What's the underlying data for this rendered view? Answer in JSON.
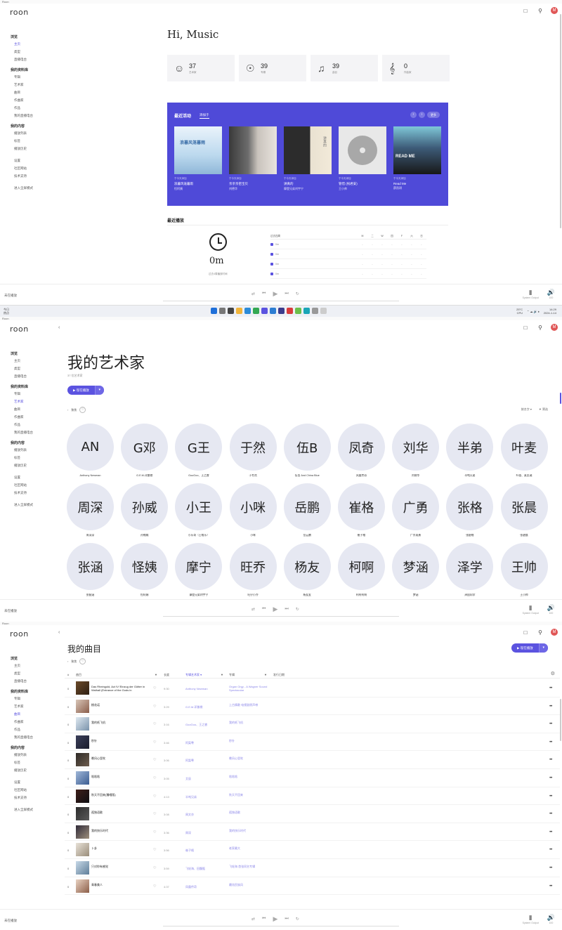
{
  "logo": "roon",
  "sidebar": {
    "sections": [
      {
        "header": "浏览",
        "items": [
          "主页",
          "类型",
          "直播电台"
        ]
      },
      {
        "header": "我的资料库",
        "items": [
          "专辑",
          "艺术家",
          "曲目",
          "作曲家",
          "作品",
          "我的直播电台"
        ]
      },
      {
        "header": "我的内容",
        "items": [
          "播放列表",
          "标签",
          "播放历史"
        ]
      },
      {
        "header": "",
        "items": [
          "设置",
          "社区网站",
          "技术支持"
        ]
      },
      {
        "header": "",
        "items": [
          "进入全屏模式"
        ]
      }
    ]
  },
  "top_icons": {
    "bookmark": "bookmark-icon",
    "search": "search-icon",
    "avatar": "M"
  },
  "playbar": {
    "status": "未在播放",
    "output_label": "System Output",
    "volume_label": "100"
  },
  "home": {
    "titlebar": "Roon",
    "greeting": "Hi, Music",
    "stats": [
      {
        "icon": "artist-icon",
        "value": "37",
        "label": "艺术家"
      },
      {
        "icon": "album-icon",
        "value": "39",
        "label": "专辑"
      },
      {
        "icon": "track-icon",
        "value": "39",
        "label": "曲目"
      },
      {
        "icon": "composer-icon",
        "value": "0",
        "label": "作曲家"
      }
    ],
    "activity": {
      "title": "最近活动",
      "tab": "添加于",
      "more": "更多",
      "cards": [
        {
          "meta": "于今天添加",
          "name": "浪暮风笼暮雨",
          "artist": "恒阿姨",
          "cover_text": "浪暮风笼暮雨"
        },
        {
          "meta": "于今天添加",
          "name": "亲亲亲密宝贝",
          "artist": "刘德华",
          "cover_text": ""
        },
        {
          "meta": "于今天添加",
          "name": "讲真的",
          "artist": "摩登兄弟刘宇宁",
          "cover_text": "讲真的"
        },
        {
          "meta": "于今天添加",
          "name": "管惜 (祝君安)",
          "artist": "王小帅",
          "cover_text": ""
        },
        {
          "meta": "于今天添加",
          "name": "Read Me",
          "artist": "薛凯琪",
          "cover_text": "READ ME"
        }
      ]
    },
    "recent": {
      "title": "最近播放",
      "value": "0m",
      "caption": "过去4周播放时间",
      "table_header": "过去四周",
      "days": [
        "M",
        "二",
        "W",
        "四",
        "F",
        "六",
        "日"
      ],
      "rows": [
        {
          "label": "0m",
          "cells": [
            "-",
            "-",
            "-",
            "-",
            "-",
            "-",
            "-"
          ]
        },
        {
          "label": "0m",
          "cells": [
            "-",
            "-",
            "-",
            "-",
            "-",
            "-",
            "-"
          ]
        },
        {
          "label": "0m",
          "cells": [
            "-",
            "-",
            "-",
            "-",
            "-",
            "-",
            "-"
          ]
        },
        {
          "label": "0m",
          "cells": [
            "-",
            "-",
            "-",
            "-",
            "-",
            "-",
            "-"
          ]
        }
      ]
    }
  },
  "taskbar": {
    "weather_line1": "今日",
    "weather_line2": "热点",
    "temp": "25°C",
    "cpu": "CPU",
    "time": "14:29",
    "date": "2024-1-14"
  },
  "artists_page": {
    "titlebar": "Roon",
    "title": "我的艺术家",
    "subtitle": "37 位艺术家",
    "play_label": "▶ 现在播放",
    "filter_label": "聚焦",
    "sort_label": "按名字 ▾",
    "filter2_label": "筛选",
    "artists": [
      {
        "initials": "AN",
        "name": "Anthony Newman"
      },
      {
        "initials": "G邓",
        "name": "G.E.M.邓紫棋"
      },
      {
        "initials": "G王",
        "name": "GooGoo、王之睿"
      },
      {
        "initials": "于然",
        "name": "于冬然"
      },
      {
        "initials": "伍B",
        "name": "伍佰 And China Blue"
      },
      {
        "initials": "凤奇",
        "name": "凤凰传奇"
      },
      {
        "initials": "刘华",
        "name": "刘德华"
      },
      {
        "initials": "半弟",
        "name": "半吨兄弟"
      },
      {
        "initials": "叶麦",
        "name": "叶蓓、麦志诚"
      },
      {
        "initials": "周深",
        "name": "周深深"
      },
      {
        "initials": "孙威",
        "name": "孙楠威"
      },
      {
        "initials": "小王",
        "name": "小乐哥（王唯乐）"
      },
      {
        "initials": "小咪",
        "name": "小咪"
      },
      {
        "initials": "岳鹏",
        "name": "岳云鹏"
      },
      {
        "initials": "崔格",
        "name": "崔子格"
      },
      {
        "initials": "广勇",
        "name": "广东雨勇"
      },
      {
        "initials": "张格",
        "name": "张碧格"
      },
      {
        "initials": "张晨",
        "name": "张碧晨"
      },
      {
        "initials": "张涵",
        "name": "张韶涵"
      },
      {
        "initials": "怪姨",
        "name": "恒阿姨"
      },
      {
        "initials": "摩宁",
        "name": "摩登兄弟刘宇宁"
      },
      {
        "initials": "旺乔",
        "name": "旺仔小乔"
      },
      {
        "initials": "杨友",
        "name": "杨友友"
      },
      {
        "initials": "柯啊",
        "name": "柯柯柯啊"
      },
      {
        "initials": "梦涵",
        "name": "梦涵"
      },
      {
        "initials": "泽学",
        "name": "泽国同学"
      },
      {
        "initials": "王帅",
        "name": "王小帅"
      }
    ]
  },
  "tracks_page": {
    "titlebar": "Roon",
    "title": "我的曲目",
    "filter_label": "聚焦",
    "play_label": "▶ 现在播放",
    "columns": {
      "num": "#",
      "track": "曲目",
      "duration": "长度",
      "artist": "专辑艺术家 ▾",
      "album": "专辑",
      "date": "发行日期"
    },
    "rows": [
      {
        "num": "0",
        "name": "Das Rheingold, Act IV:'Einzug der Götter in Walhall (Entrance of the Gods in",
        "duration": "9:30",
        "artist": "Anthony Newman",
        "album": "Organ Orgy - A Wagner Sound Spectacular"
      },
      {
        "num": "0",
        "name": "桃花诺",
        "duration": "3:29",
        "artist": "G.E.M.邓紫棋",
        "album": "上古情歌 电视剧原声带"
      },
      {
        "num": "0",
        "name": "我的纸飞机",
        "duration": "3:16",
        "artist": "GooGoo、王之睿",
        "album": "我的纸飞机"
      },
      {
        "num": "0",
        "name": "秒针",
        "duration": "3:46",
        "artist": "阿梨粤",
        "album": "秒针"
      },
      {
        "num": "0",
        "name": "晚风心里吹",
        "duration": "3:06",
        "artist": "阿梨粤",
        "album": "晚风心里吹"
      },
      {
        "num": "0",
        "name": "啥啥啥",
        "duration": "3:05",
        "artist": "艾辰",
        "album": "啥啥啥"
      },
      {
        "num": "0",
        "name": "秋天不回来(獨唱版)",
        "duration": "4:13",
        "artist": "半吨兄弟",
        "album": "秋天不回来"
      },
      {
        "num": "0",
        "name": "孤独语歌",
        "duration": "3:08",
        "artist": "周文亦",
        "album": "孤独语歌"
      },
      {
        "num": "0",
        "name": "我的快乐时代",
        "duration": "3:36",
        "artist": "周深",
        "album": "我的快乐时代"
      },
      {
        "num": "0",
        "name": "卜卦",
        "duration": "3:56",
        "artist": "崔子格",
        "album": "老家最大"
      },
      {
        "num": "0",
        "name": "只对你有感觉",
        "duration": "3:59",
        "artist": "飞轮海、田馥甄",
        "album": "飞轮海 首张同名专辑"
      },
      {
        "num": "0",
        "name": "青春美人",
        "duration": "4:37",
        "artist": "凤凰传奇",
        "album": "最炫民族风"
      }
    ]
  },
  "colors": {
    "accent": "#5b53e0",
    "activity_bg": "#4f4ad8",
    "circle_bg": "#e6e8f2"
  }
}
